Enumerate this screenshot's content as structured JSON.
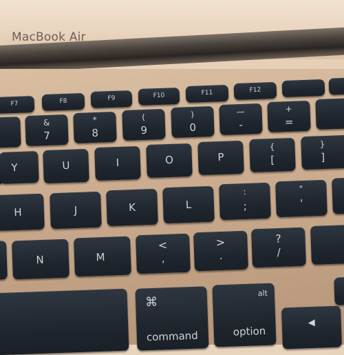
{
  "bezel": {
    "brand": "MacBook Air"
  },
  "keys": {
    "fn_row": [
      {
        "label": "F7"
      },
      {
        "label": "F8"
      },
      {
        "label": "F9"
      },
      {
        "label": "F10"
      },
      {
        "label": "F11"
      },
      {
        "label": "F12"
      },
      {
        "label": ""
      }
    ],
    "number_row": {
      "seven": {
        "top": "&",
        "bottom": "7"
      },
      "eight": {
        "top": "*",
        "bottom": "8"
      },
      "nine": {
        "top": "(",
        "bottom": "9"
      },
      "zero": {
        "top": ")",
        "bottom": "0"
      },
      "minus": {
        "top": "—",
        "bottom": "-"
      },
      "equal": {
        "top": "+",
        "bottom": "="
      }
    },
    "top_row": {
      "y": "Y",
      "u": "U",
      "i": "I",
      "o": "O",
      "p": "P",
      "lbrace": {
        "top": "{",
        "bottom": "["
      },
      "rbrace": {
        "top": "}",
        "bottom": "]"
      }
    },
    "home_row": {
      "h": "H",
      "j": "J",
      "k": "K",
      "l": "L",
      "semicolon": {
        "top": ":",
        "bottom": ";"
      },
      "quote": {
        "top": "\"",
        "bottom": "'"
      }
    },
    "bottom_row": {
      "n": "N",
      "m": "M",
      "comma": {
        "top": "<",
        "bottom": ","
      },
      "period": {
        "top": ">",
        "bottom": "."
      },
      "slash": {
        "top": "?",
        "bottom": "/"
      }
    },
    "modifiers": {
      "command": {
        "symbol": "⌘",
        "label": "command"
      },
      "option": {
        "top": "alt",
        "label": "option"
      },
      "left_arrow": "◀"
    }
  }
}
